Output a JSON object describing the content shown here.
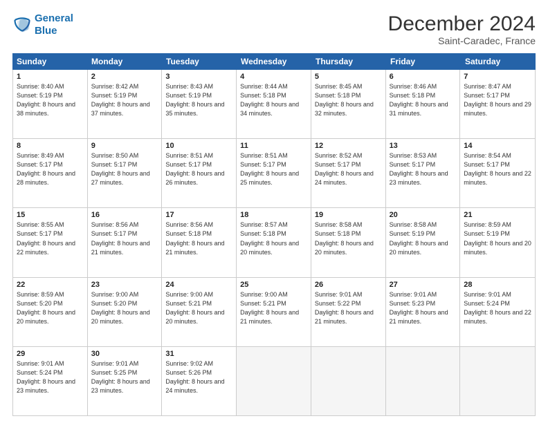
{
  "logo": {
    "line1": "General",
    "line2": "Blue"
  },
  "title": "December 2024",
  "subtitle": "Saint-Caradec, France",
  "days": [
    "Sunday",
    "Monday",
    "Tuesday",
    "Wednesday",
    "Thursday",
    "Friday",
    "Saturday"
  ],
  "weeks": [
    [
      {
        "day": "1",
        "sunrise": "Sunrise: 8:40 AM",
        "sunset": "Sunset: 5:19 PM",
        "daylight": "Daylight: 8 hours and 38 minutes."
      },
      {
        "day": "2",
        "sunrise": "Sunrise: 8:42 AM",
        "sunset": "Sunset: 5:19 PM",
        "daylight": "Daylight: 8 hours and 37 minutes."
      },
      {
        "day": "3",
        "sunrise": "Sunrise: 8:43 AM",
        "sunset": "Sunset: 5:19 PM",
        "daylight": "Daylight: 8 hours and 35 minutes."
      },
      {
        "day": "4",
        "sunrise": "Sunrise: 8:44 AM",
        "sunset": "Sunset: 5:18 PM",
        "daylight": "Daylight: 8 hours and 34 minutes."
      },
      {
        "day": "5",
        "sunrise": "Sunrise: 8:45 AM",
        "sunset": "Sunset: 5:18 PM",
        "daylight": "Daylight: 8 hours and 32 minutes."
      },
      {
        "day": "6",
        "sunrise": "Sunrise: 8:46 AM",
        "sunset": "Sunset: 5:18 PM",
        "daylight": "Daylight: 8 hours and 31 minutes."
      },
      {
        "day": "7",
        "sunrise": "Sunrise: 8:47 AM",
        "sunset": "Sunset: 5:17 PM",
        "daylight": "Daylight: 8 hours and 29 minutes."
      }
    ],
    [
      {
        "day": "8",
        "sunrise": "Sunrise: 8:49 AM",
        "sunset": "Sunset: 5:17 PM",
        "daylight": "Daylight: 8 hours and 28 minutes."
      },
      {
        "day": "9",
        "sunrise": "Sunrise: 8:50 AM",
        "sunset": "Sunset: 5:17 PM",
        "daylight": "Daylight: 8 hours and 27 minutes."
      },
      {
        "day": "10",
        "sunrise": "Sunrise: 8:51 AM",
        "sunset": "Sunset: 5:17 PM",
        "daylight": "Daylight: 8 hours and 26 minutes."
      },
      {
        "day": "11",
        "sunrise": "Sunrise: 8:51 AM",
        "sunset": "Sunset: 5:17 PM",
        "daylight": "Daylight: 8 hours and 25 minutes."
      },
      {
        "day": "12",
        "sunrise": "Sunrise: 8:52 AM",
        "sunset": "Sunset: 5:17 PM",
        "daylight": "Daylight: 8 hours and 24 minutes."
      },
      {
        "day": "13",
        "sunrise": "Sunrise: 8:53 AM",
        "sunset": "Sunset: 5:17 PM",
        "daylight": "Daylight: 8 hours and 23 minutes."
      },
      {
        "day": "14",
        "sunrise": "Sunrise: 8:54 AM",
        "sunset": "Sunset: 5:17 PM",
        "daylight": "Daylight: 8 hours and 22 minutes."
      }
    ],
    [
      {
        "day": "15",
        "sunrise": "Sunrise: 8:55 AM",
        "sunset": "Sunset: 5:17 PM",
        "daylight": "Daylight: 8 hours and 22 minutes."
      },
      {
        "day": "16",
        "sunrise": "Sunrise: 8:56 AM",
        "sunset": "Sunset: 5:17 PM",
        "daylight": "Daylight: 8 hours and 21 minutes."
      },
      {
        "day": "17",
        "sunrise": "Sunrise: 8:56 AM",
        "sunset": "Sunset: 5:18 PM",
        "daylight": "Daylight: 8 hours and 21 minutes."
      },
      {
        "day": "18",
        "sunrise": "Sunrise: 8:57 AM",
        "sunset": "Sunset: 5:18 PM",
        "daylight": "Daylight: 8 hours and 20 minutes."
      },
      {
        "day": "19",
        "sunrise": "Sunrise: 8:58 AM",
        "sunset": "Sunset: 5:18 PM",
        "daylight": "Daylight: 8 hours and 20 minutes."
      },
      {
        "day": "20",
        "sunrise": "Sunrise: 8:58 AM",
        "sunset": "Sunset: 5:19 PM",
        "daylight": "Daylight: 8 hours and 20 minutes."
      },
      {
        "day": "21",
        "sunrise": "Sunrise: 8:59 AM",
        "sunset": "Sunset: 5:19 PM",
        "daylight": "Daylight: 8 hours and 20 minutes."
      }
    ],
    [
      {
        "day": "22",
        "sunrise": "Sunrise: 8:59 AM",
        "sunset": "Sunset: 5:20 PM",
        "daylight": "Daylight: 8 hours and 20 minutes."
      },
      {
        "day": "23",
        "sunrise": "Sunrise: 9:00 AM",
        "sunset": "Sunset: 5:20 PM",
        "daylight": "Daylight: 8 hours and 20 minutes."
      },
      {
        "day": "24",
        "sunrise": "Sunrise: 9:00 AM",
        "sunset": "Sunset: 5:21 PM",
        "daylight": "Daylight: 8 hours and 20 minutes."
      },
      {
        "day": "25",
        "sunrise": "Sunrise: 9:00 AM",
        "sunset": "Sunset: 5:21 PM",
        "daylight": "Daylight: 8 hours and 21 minutes."
      },
      {
        "day": "26",
        "sunrise": "Sunrise: 9:01 AM",
        "sunset": "Sunset: 5:22 PM",
        "daylight": "Daylight: 8 hours and 21 minutes."
      },
      {
        "day": "27",
        "sunrise": "Sunrise: 9:01 AM",
        "sunset": "Sunset: 5:23 PM",
        "daylight": "Daylight: 8 hours and 21 minutes."
      },
      {
        "day": "28",
        "sunrise": "Sunrise: 9:01 AM",
        "sunset": "Sunset: 5:24 PM",
        "daylight": "Daylight: 8 hours and 22 minutes."
      }
    ],
    [
      {
        "day": "29",
        "sunrise": "Sunrise: 9:01 AM",
        "sunset": "Sunset: 5:24 PM",
        "daylight": "Daylight: 8 hours and 23 minutes."
      },
      {
        "day": "30",
        "sunrise": "Sunrise: 9:01 AM",
        "sunset": "Sunset: 5:25 PM",
        "daylight": "Daylight: 8 hours and 23 minutes."
      },
      {
        "day": "31",
        "sunrise": "Sunrise: 9:02 AM",
        "sunset": "Sunset: 5:26 PM",
        "daylight": "Daylight: 8 hours and 24 minutes."
      },
      null,
      null,
      null,
      null
    ]
  ]
}
